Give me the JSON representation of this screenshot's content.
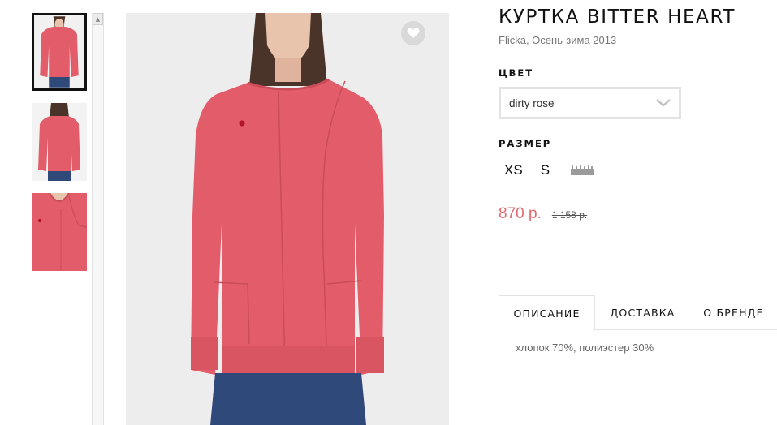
{
  "product": {
    "title": "КУРТКА BITTER HEART",
    "subtitle": "Flicka, Осень-зима 2013",
    "color_label": "ЦВЕТ",
    "color_value": "dirty rose",
    "size_label": "РАЗМЕР",
    "sizes": [
      "XS",
      "S"
    ],
    "price_current": "870 р.",
    "price_old": "1 158 р."
  },
  "tabs": [
    {
      "label": "ОПИСАНИЕ",
      "active": true
    },
    {
      "label": "ДОСТАВКА",
      "active": false
    },
    {
      "label": "О БРЕНДЕ",
      "active": false
    }
  ],
  "description": "хлопок 70%, полиэстер 30%",
  "colors": {
    "garment": "#e25d69",
    "price": "#e06a6e",
    "jeans": "#2f4a7a",
    "skin": "#e8c4ad",
    "hair": "#4a3328"
  },
  "icons": {
    "favorite": "heart-icon",
    "dropdown": "chevron-down-icon",
    "size_guide": "ruler-icon",
    "scroll_up": "scroll-up-arrow-icon"
  }
}
